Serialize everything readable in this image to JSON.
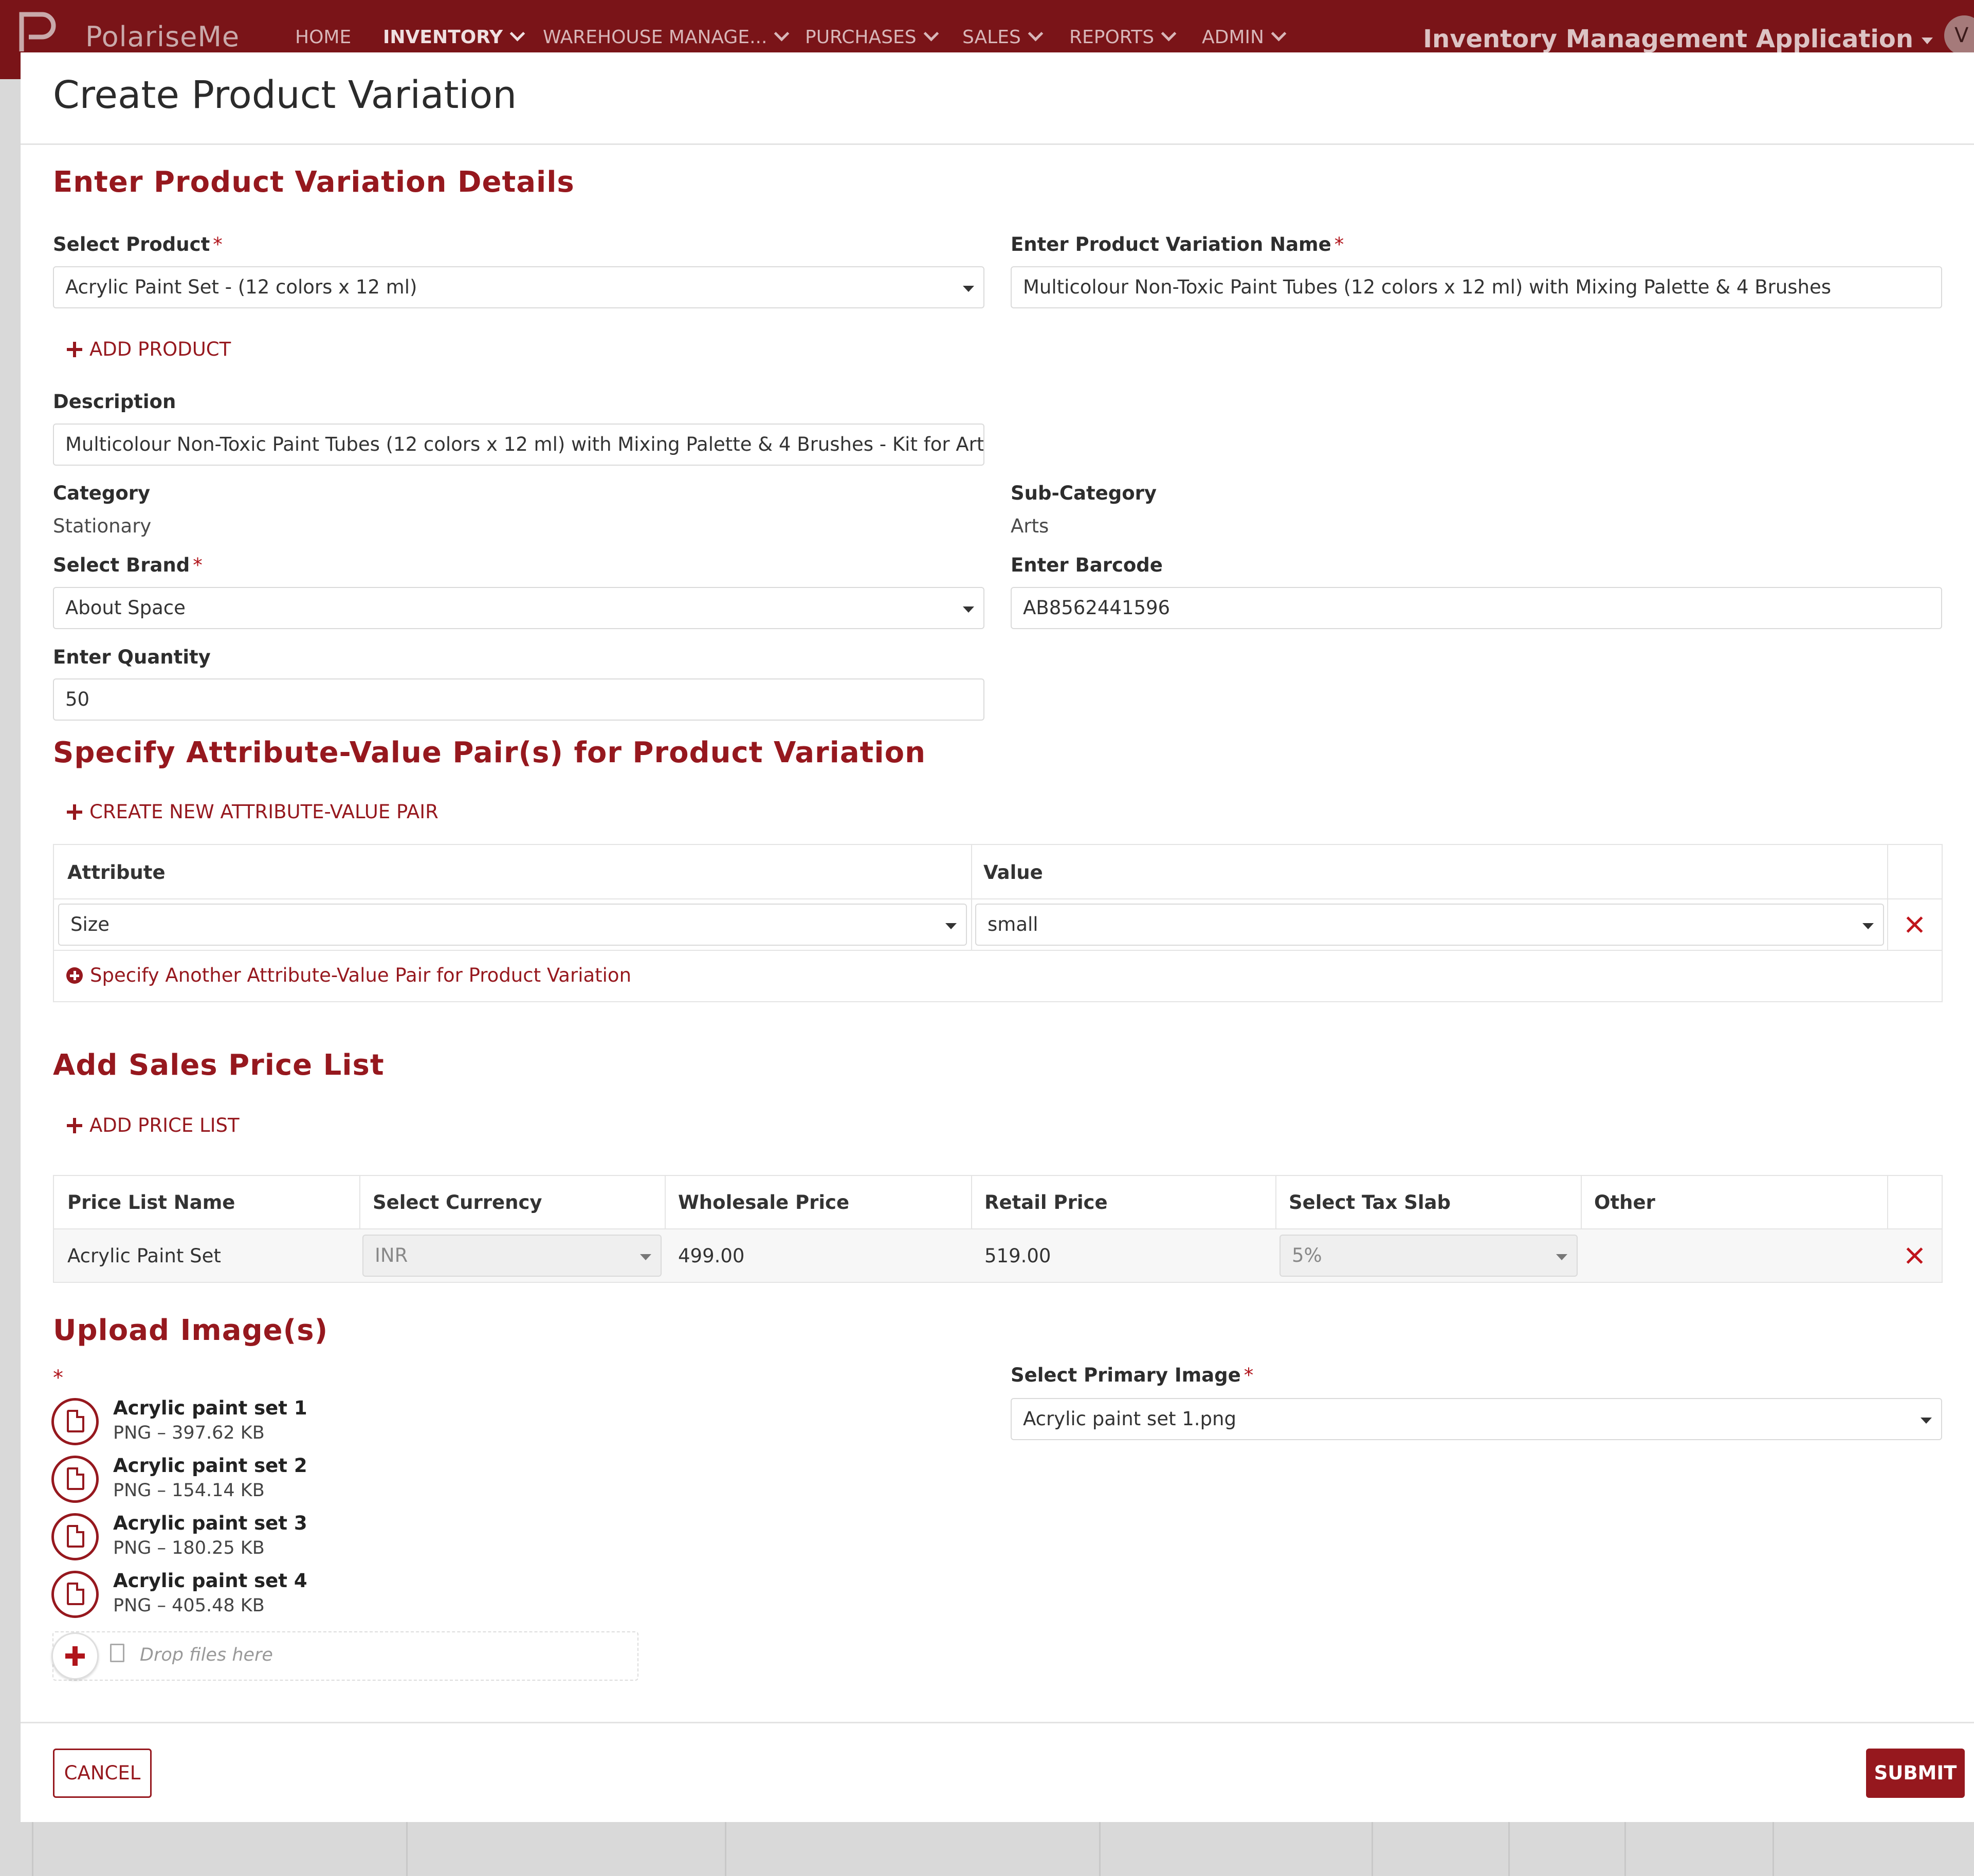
{
  "navbar": {
    "brand": "PolariseMe",
    "items": [
      {
        "label": "HOME",
        "active": false,
        "dropdown": false
      },
      {
        "label": "INVENTORY",
        "active": true,
        "dropdown": true
      },
      {
        "label": "WAREHOUSE MANAGE...",
        "active": false,
        "dropdown": true
      },
      {
        "label": "PURCHASES",
        "active": false,
        "dropdown": true
      },
      {
        "label": "SALES",
        "active": false,
        "dropdown": true
      },
      {
        "label": "REPORTS",
        "active": false,
        "dropdown": true
      },
      {
        "label": "ADMIN",
        "active": false,
        "dropdown": true
      }
    ],
    "app_name": "Inventory Management Application",
    "avatar_initial": "V"
  },
  "dialog": {
    "title": "Create Product Variation",
    "details": {
      "heading": "Enter Product Variation Details",
      "select_product_label": "Select Product",
      "select_product_value": "Acrylic Paint Set - (12 colors x 12 ml)",
      "variation_name_label": "Enter Product Variation Name",
      "variation_name_value": "Multicolour Non-Toxic Paint Tubes (12 colors x 12 ml) with Mixing Palette & 4 Brushes",
      "add_product": "ADD PRODUCT",
      "description_label": "Description",
      "description_value": "Multicolour Non-Toxic Paint Tubes (12 colors x 12 ml) with Mixing Palette & 4 Brushes - Kit for Art & Craft",
      "category_label": "Category",
      "category_value": "Stationary",
      "subcategory_label": "Sub-Category",
      "subcategory_value": "Arts",
      "brand_label": "Select Brand",
      "brand_value": "About Space",
      "barcode_label": "Enter Barcode",
      "barcode_value": "AB8562441596",
      "quantity_label": "Enter Quantity",
      "quantity_value": "50",
      "required_mark": "*"
    },
    "attributes": {
      "heading": "Specify Attribute-Value Pair(s) for Product Variation",
      "create_link": "CREATE NEW ATTRIBUTE-VALUE PAIR",
      "col_attribute": "Attribute",
      "col_value": "Value",
      "rows": [
        {
          "attribute": "Size",
          "value": "small"
        }
      ],
      "add_another": "Specify Another Attribute-Value Pair for Product Variation"
    },
    "pricing": {
      "heading": "Add Sales Price List",
      "add_link": "ADD PRICE LIST",
      "columns": [
        "Price List Name",
        "Select Currency",
        "Wholesale Price",
        "Retail Price",
        "Select Tax Slab",
        "Other"
      ],
      "rows": [
        {
          "name": "Acrylic Paint Set",
          "currency": "INR",
          "wholesale": "499.00",
          "retail": "519.00",
          "tax": "5%",
          "other": ""
        }
      ]
    },
    "images": {
      "heading": "Upload Image(s)",
      "required_mark": "*",
      "files": [
        {
          "name": "Acrylic paint set 1",
          "meta": "PNG – 397.62 KB"
        },
        {
          "name": "Acrylic paint set 2",
          "meta": "PNG – 154.14 KB"
        },
        {
          "name": "Acrylic paint set 3",
          "meta": "PNG – 180.25 KB"
        },
        {
          "name": "Acrylic paint set 4",
          "meta": "PNG – 405.48 KB"
        }
      ],
      "drop_text": "Drop files here",
      "primary_label": "Select Primary Image",
      "primary_value": "Acrylic paint set 1.png"
    },
    "cancel_label": "CANCEL",
    "submit_label": "SUBMIT"
  },
  "colors": {
    "brand": "#7a1418",
    "accent": "#96181e",
    "delete": "#c0141b"
  }
}
